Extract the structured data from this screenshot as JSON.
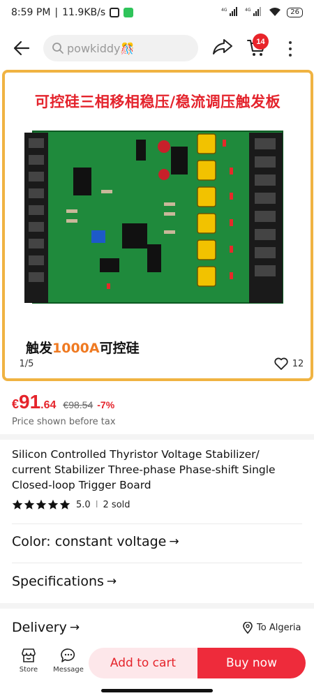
{
  "status_bar": {
    "time": "8:59 PM",
    "speed": "11.9KB/s",
    "network_label": "4G",
    "battery": "26"
  },
  "search": {
    "query": "powkiddy🎊"
  },
  "header": {
    "cart_count": "14"
  },
  "product_image": {
    "banner_text": "可控硅三相移相稳压/稳流调压触发板",
    "caption_prefix": "触发",
    "caption_highlight": "1000A",
    "caption_suffix": "可控硅",
    "counter": "1/5",
    "likes": "12"
  },
  "price": {
    "currency": "€",
    "integer": "91",
    "decimal": ".64",
    "original": "€98.54",
    "discount": "-7%",
    "tax_note": "Price shown before tax"
  },
  "product": {
    "title": "Silicon Controlled Thyristor Voltage Stabilizer/ current Stabilizer Three-phase Phase-shift Single Closed-loop Trigger Board",
    "rating": "5.0",
    "rating_stars": 5,
    "sold": "2 sold"
  },
  "options": {
    "color_label": "Color: constant voltage",
    "specifications_label": "Specifications"
  },
  "delivery": {
    "label": "Delivery",
    "destination": "To Algeria"
  },
  "bottom_bar": {
    "store_label": "Store",
    "message_label": "Message",
    "add_to_cart_label": "Add to cart",
    "buy_now_label": "Buy now"
  },
  "colors": {
    "accent_red": "#e5242b",
    "image_border": "#f0b342",
    "pcb_green": "#1f8a3c"
  }
}
